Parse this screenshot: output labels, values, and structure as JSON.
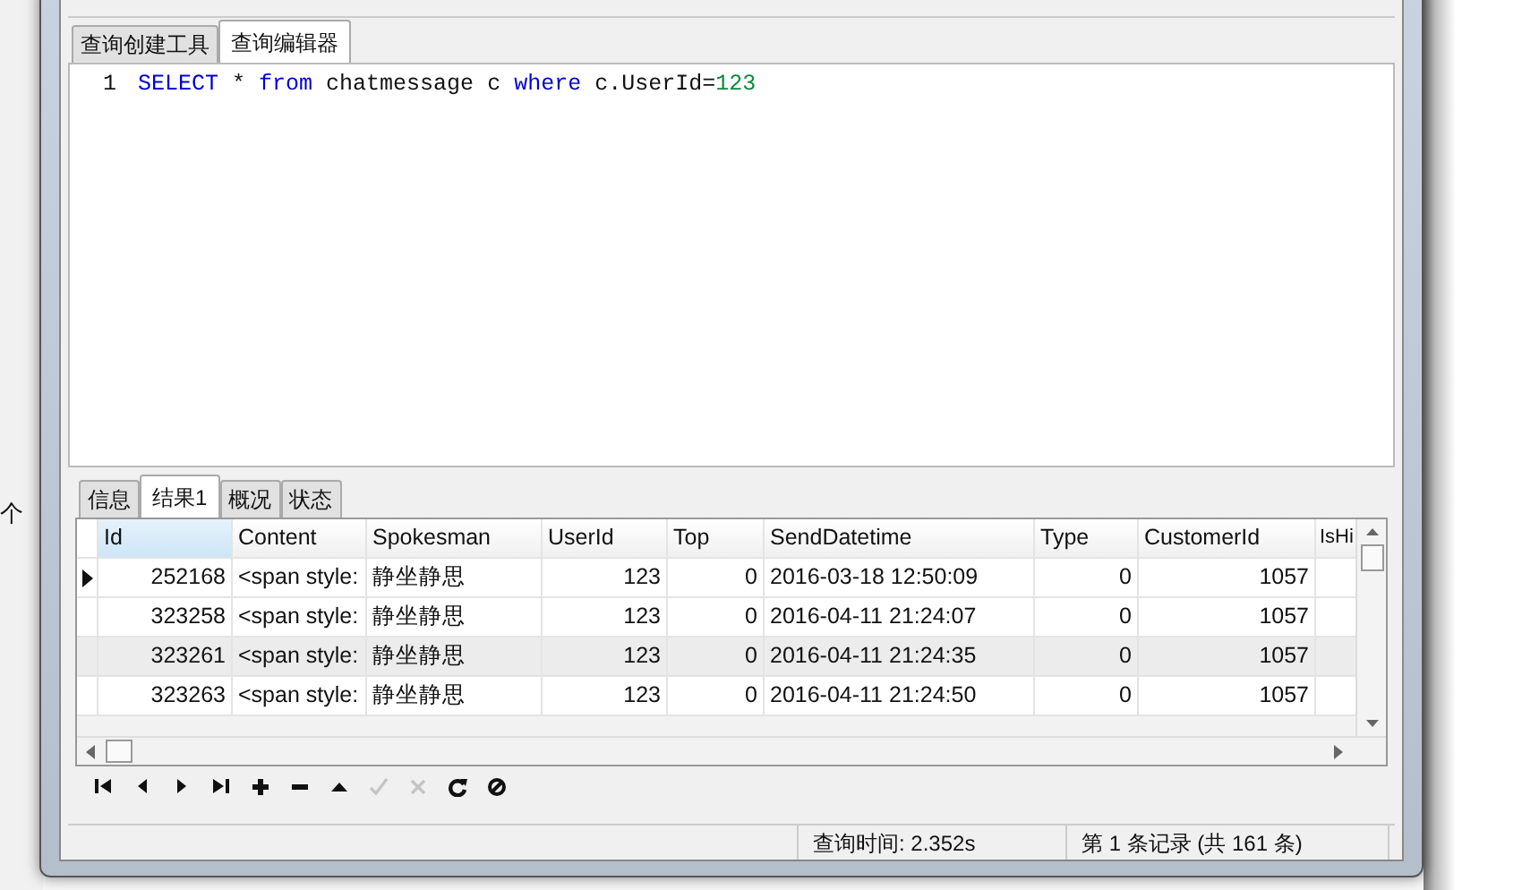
{
  "background": {
    "text": "个"
  },
  "editor_tabs": [
    {
      "label": "查询创建工具",
      "selected": false
    },
    {
      "label": "查询编辑器",
      "selected": true
    }
  ],
  "editor": {
    "lines": [
      {
        "number": "1",
        "tokens": [
          {
            "text": "SELECT",
            "kind": "keyword"
          },
          {
            "text": " * ",
            "kind": "plain"
          },
          {
            "text": "from",
            "kind": "keyword"
          },
          {
            "text": " chatmessage c ",
            "kind": "plain"
          },
          {
            "text": "where",
            "kind": "keyword"
          },
          {
            "text": " c.UserId=",
            "kind": "plain"
          },
          {
            "text": "123",
            "kind": "number"
          }
        ]
      }
    ]
  },
  "result_tabs": [
    {
      "label": "信息",
      "selected": false
    },
    {
      "label": "结果1",
      "selected": true
    },
    {
      "label": "概况",
      "selected": false
    },
    {
      "label": "状态",
      "selected": false
    }
  ],
  "table": {
    "columns": [
      {
        "label": "Id",
        "selected": true
      },
      {
        "label": "Content",
        "selected": false
      },
      {
        "label": "Spokesman",
        "selected": false
      },
      {
        "label": "UserId",
        "selected": false
      },
      {
        "label": "Top",
        "selected": false
      },
      {
        "label": "SendDatetime",
        "selected": false
      },
      {
        "label": "Type",
        "selected": false
      },
      {
        "label": "CustomerId",
        "selected": false
      },
      {
        "label": "IsHi",
        "selected": false
      }
    ],
    "rows": [
      {
        "current": true,
        "shaded": false,
        "cells": [
          "252168",
          "<span style:",
          "静坐静思",
          "123",
          "0",
          "2016-03-18 12:50:09",
          "0",
          "1057",
          ""
        ]
      },
      {
        "current": false,
        "shaded": false,
        "cells": [
          "323258",
          "<span style:",
          "静坐静思",
          "123",
          "0",
          "2016-04-11 21:24:07",
          "0",
          "1057",
          ""
        ]
      },
      {
        "current": false,
        "shaded": true,
        "cells": [
          "323261",
          "<span style:",
          "静坐静思",
          "123",
          "0",
          "2016-04-11 21:24:35",
          "0",
          "1057",
          ""
        ]
      },
      {
        "current": false,
        "shaded": false,
        "cells": [
          "323263",
          "<span style:",
          "静坐静思",
          "123",
          "0",
          "2016-04-11 21:24:50",
          "0",
          "1057",
          ""
        ]
      }
    ]
  },
  "toolbar": [
    {
      "kind": "first",
      "disabled": false
    },
    {
      "kind": "prev",
      "disabled": false
    },
    {
      "kind": "next",
      "disabled": false
    },
    {
      "kind": "last",
      "disabled": false
    },
    {
      "kind": "add",
      "disabled": false
    },
    {
      "kind": "remove",
      "disabled": false
    },
    {
      "kind": "up",
      "disabled": false
    },
    {
      "kind": "apply",
      "disabled": true
    },
    {
      "kind": "cancel",
      "disabled": true
    },
    {
      "kind": "refresh",
      "disabled": false
    },
    {
      "kind": "stop",
      "disabled": false
    }
  ],
  "status_bar": {
    "query_time": "查询时间: 2.352s",
    "record": "第 1 条记录 (共 161 条)"
  }
}
